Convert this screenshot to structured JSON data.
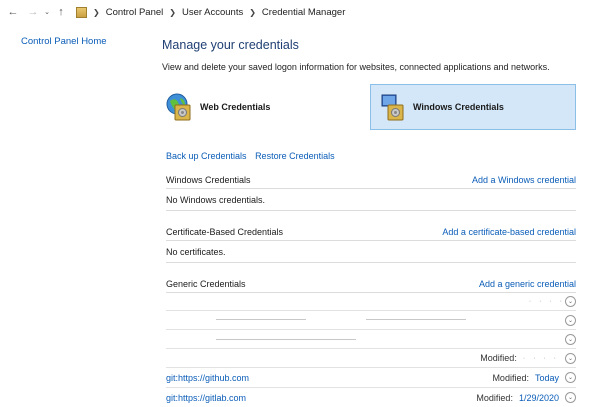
{
  "address": {
    "crumbs": [
      "Control Panel",
      "User Accounts",
      "Credential Manager"
    ],
    "back_icon": "arrow-left-icon",
    "forward_icon": "arrow-right-icon",
    "recent_icon": "chevron-down-icon",
    "up_icon": "arrow-up-icon"
  },
  "sidebar": {
    "home_link": "Control Panel Home"
  },
  "main": {
    "title": "Manage your credentials",
    "subtitle": "View and delete your saved logon information for websites, connected applications and networks.",
    "types": [
      {
        "label": "Web Credentials"
      },
      {
        "label": "Windows Credentials"
      }
    ],
    "backup": "Back up Credentials",
    "restore": "Restore Credentials"
  },
  "windows_section": {
    "title": "Windows Credentials",
    "action": "Add a Windows credential",
    "empty": "No Windows credentials."
  },
  "cert_section": {
    "title": "Certificate-Based Credentials",
    "action": "Add a certificate-based credential",
    "empty": "No certificates."
  },
  "generic_section": {
    "title": "Generic Credentials",
    "action": "Add a generic credential",
    "rows": [
      {
        "name": "",
        "modified_label": "",
        "modified_value": ""
      },
      {
        "name": "",
        "modified_label": "",
        "modified_value": ""
      },
      {
        "name": "",
        "modified_label": "",
        "modified_value": ""
      },
      {
        "name": "",
        "modified_label": "Modified:",
        "modified_value": ""
      },
      {
        "name": "git:https://github.com",
        "modified_label": "Modified:",
        "modified_value": "Today"
      },
      {
        "name": "git:https://gitlab.com",
        "modified_label": "Modified:",
        "modified_value": "1/29/2020"
      }
    ]
  },
  "colors": {
    "link": "#0b5db8",
    "selected_tile": "#d3e7f8",
    "selected_border": "#8cbfe8",
    "title": "#1f3f73"
  }
}
